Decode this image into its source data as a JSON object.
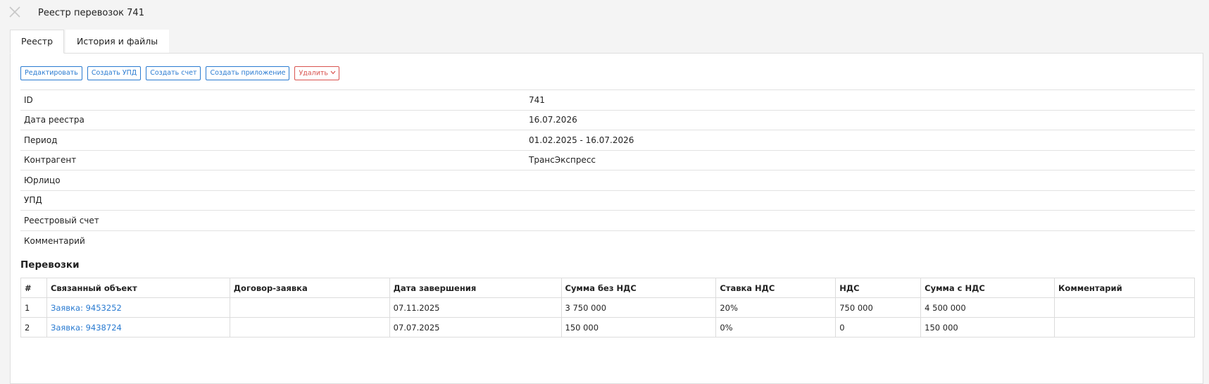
{
  "window": {
    "title": "Реестр перевозок 741",
    "close_icon": "close-icon"
  },
  "tabs": [
    {
      "label": "Реестр",
      "active": true
    },
    {
      "label": "История и файлы",
      "active": false
    }
  ],
  "toolbar": {
    "edit_label": "Редактировать",
    "create_upd_label": "Создать УПД",
    "create_invoice_label": "Создать счет",
    "create_attachment_label": "Создать приложение",
    "delete_label": "Удалить"
  },
  "details": [
    {
      "key": "ID",
      "value": "741"
    },
    {
      "key": "Дата реестра",
      "value": "16.07.2026"
    },
    {
      "key": "Период",
      "value": "01.02.2025 - 16.07.2026"
    },
    {
      "key": "Контрагент",
      "value": "ТрансЭкспресс"
    },
    {
      "key": "Юрлицо",
      "value": ""
    },
    {
      "key": "УПД",
      "value": ""
    },
    {
      "key": "Реестровый счет",
      "value": ""
    },
    {
      "key": "Комментарий",
      "value": ""
    }
  ],
  "transports": {
    "title": "Перевозки",
    "columns": [
      "#",
      "Связанный объект",
      "Договор-заявка",
      "Дата завершения",
      "Сумма без НДС",
      "Ставка НДС",
      "НДС",
      "Сумма с НДС",
      "Комментарий"
    ],
    "rows": [
      [
        "1",
        "Заявка: 9453252",
        "",
        "07.11.2025",
        "3 750 000",
        "20%",
        "750 000",
        "4 500 000",
        ""
      ],
      [
        "2",
        "Заявка: 9438724",
        "",
        "07.07.2025",
        "150 000",
        "0%",
        "0",
        "150 000",
        ""
      ]
    ]
  }
}
